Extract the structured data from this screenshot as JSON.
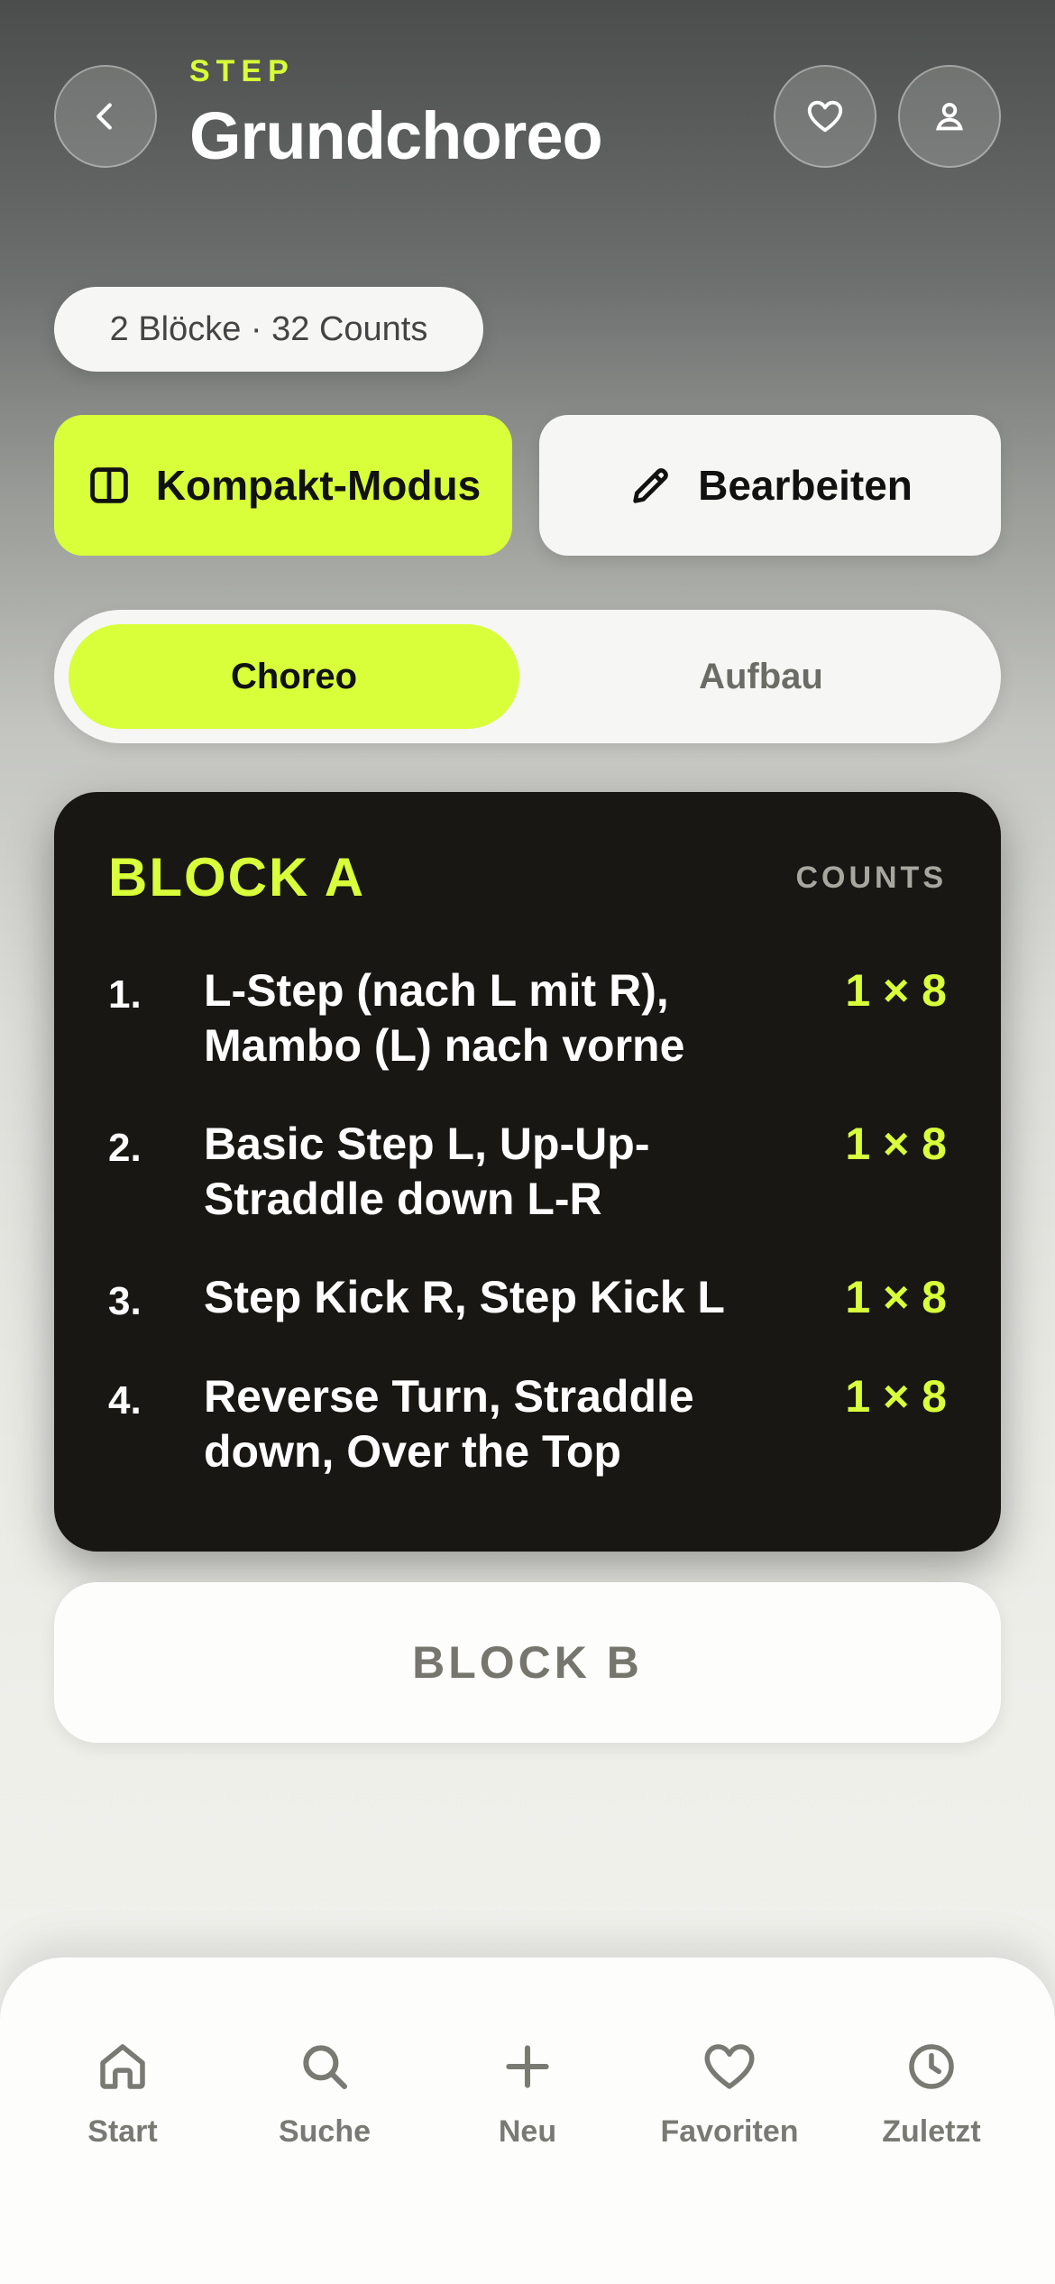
{
  "header": {
    "eyebrow": "STEP",
    "title": "Grundchoreo",
    "back_icon": "chevron-left-icon",
    "favorite_icon": "heart-icon",
    "profile_icon": "user-icon"
  },
  "meta": {
    "summary": "2 Blöcke · 32 Counts"
  },
  "actions": {
    "compact_label": "Kompakt-Modus",
    "compact_icon": "columns-icon",
    "edit_label": "Bearbeiten",
    "edit_icon": "pencil-icon"
  },
  "segments": {
    "active": "Choreo",
    "inactive": "Aufbau"
  },
  "block_a": {
    "title": "BLOCK A",
    "counts_header": "COUNTS",
    "steps": [
      {
        "num": "1.",
        "text": "L-Step (nach L mit R), Mambo (L) nach vorne",
        "count": "1 × 8"
      },
      {
        "num": "2.",
        "text": "Basic Step L, Up-Up-Straddle down L-R",
        "count": "1 × 8"
      },
      {
        "num": "3.",
        "text": "Step Kick R, Step Kick L",
        "count": "1 × 8"
      },
      {
        "num": "4.",
        "text": "Reverse Turn, Straddle down, Over the Top",
        "count": "1 × 8"
      }
    ]
  },
  "block_b": {
    "title": "BLOCK B"
  },
  "nav": {
    "items": [
      {
        "label": "Start",
        "icon": "home-icon"
      },
      {
        "label": "Suche",
        "icon": "search-icon"
      },
      {
        "label": "Neu",
        "icon": "plus-icon"
      },
      {
        "label": "Favoriten",
        "icon": "heart-icon"
      },
      {
        "label": "Zuletzt",
        "icon": "clock-icon"
      }
    ]
  },
  "colors": {
    "accent": "#d8ff3a",
    "dark_card": "#181713"
  }
}
